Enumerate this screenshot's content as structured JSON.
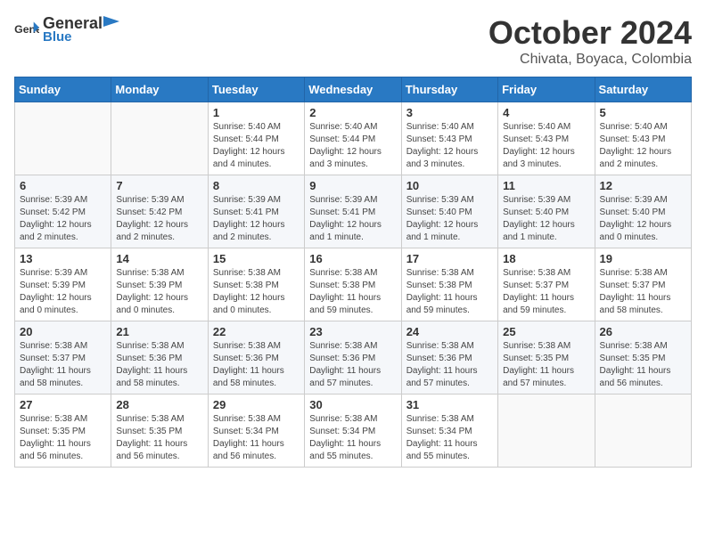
{
  "header": {
    "logo_general": "General",
    "logo_blue": "Blue",
    "month": "October 2024",
    "location": "Chivata, Boyaca, Colombia"
  },
  "weekdays": [
    "Sunday",
    "Monday",
    "Tuesday",
    "Wednesday",
    "Thursday",
    "Friday",
    "Saturday"
  ],
  "weeks": [
    [
      {
        "day": "",
        "detail": ""
      },
      {
        "day": "",
        "detail": ""
      },
      {
        "day": "1",
        "detail": "Sunrise: 5:40 AM\nSunset: 5:44 PM\nDaylight: 12 hours and 4 minutes."
      },
      {
        "day": "2",
        "detail": "Sunrise: 5:40 AM\nSunset: 5:44 PM\nDaylight: 12 hours and 3 minutes."
      },
      {
        "day": "3",
        "detail": "Sunrise: 5:40 AM\nSunset: 5:43 PM\nDaylight: 12 hours and 3 minutes."
      },
      {
        "day": "4",
        "detail": "Sunrise: 5:40 AM\nSunset: 5:43 PM\nDaylight: 12 hours and 3 minutes."
      },
      {
        "day": "5",
        "detail": "Sunrise: 5:40 AM\nSunset: 5:43 PM\nDaylight: 12 hours and 2 minutes."
      }
    ],
    [
      {
        "day": "6",
        "detail": "Sunrise: 5:39 AM\nSunset: 5:42 PM\nDaylight: 12 hours and 2 minutes."
      },
      {
        "day": "7",
        "detail": "Sunrise: 5:39 AM\nSunset: 5:42 PM\nDaylight: 12 hours and 2 minutes."
      },
      {
        "day": "8",
        "detail": "Sunrise: 5:39 AM\nSunset: 5:41 PM\nDaylight: 12 hours and 2 minutes."
      },
      {
        "day": "9",
        "detail": "Sunrise: 5:39 AM\nSunset: 5:41 PM\nDaylight: 12 hours and 1 minute."
      },
      {
        "day": "10",
        "detail": "Sunrise: 5:39 AM\nSunset: 5:40 PM\nDaylight: 12 hours and 1 minute."
      },
      {
        "day": "11",
        "detail": "Sunrise: 5:39 AM\nSunset: 5:40 PM\nDaylight: 12 hours and 1 minute."
      },
      {
        "day": "12",
        "detail": "Sunrise: 5:39 AM\nSunset: 5:40 PM\nDaylight: 12 hours and 0 minutes."
      }
    ],
    [
      {
        "day": "13",
        "detail": "Sunrise: 5:39 AM\nSunset: 5:39 PM\nDaylight: 12 hours and 0 minutes."
      },
      {
        "day": "14",
        "detail": "Sunrise: 5:38 AM\nSunset: 5:39 PM\nDaylight: 12 hours and 0 minutes."
      },
      {
        "day": "15",
        "detail": "Sunrise: 5:38 AM\nSunset: 5:38 PM\nDaylight: 12 hours and 0 minutes."
      },
      {
        "day": "16",
        "detail": "Sunrise: 5:38 AM\nSunset: 5:38 PM\nDaylight: 11 hours and 59 minutes."
      },
      {
        "day": "17",
        "detail": "Sunrise: 5:38 AM\nSunset: 5:38 PM\nDaylight: 11 hours and 59 minutes."
      },
      {
        "day": "18",
        "detail": "Sunrise: 5:38 AM\nSunset: 5:37 PM\nDaylight: 11 hours and 59 minutes."
      },
      {
        "day": "19",
        "detail": "Sunrise: 5:38 AM\nSunset: 5:37 PM\nDaylight: 11 hours and 58 minutes."
      }
    ],
    [
      {
        "day": "20",
        "detail": "Sunrise: 5:38 AM\nSunset: 5:37 PM\nDaylight: 11 hours and 58 minutes."
      },
      {
        "day": "21",
        "detail": "Sunrise: 5:38 AM\nSunset: 5:36 PM\nDaylight: 11 hours and 58 minutes."
      },
      {
        "day": "22",
        "detail": "Sunrise: 5:38 AM\nSunset: 5:36 PM\nDaylight: 11 hours and 58 minutes."
      },
      {
        "day": "23",
        "detail": "Sunrise: 5:38 AM\nSunset: 5:36 PM\nDaylight: 11 hours and 57 minutes."
      },
      {
        "day": "24",
        "detail": "Sunrise: 5:38 AM\nSunset: 5:36 PM\nDaylight: 11 hours and 57 minutes."
      },
      {
        "day": "25",
        "detail": "Sunrise: 5:38 AM\nSunset: 5:35 PM\nDaylight: 11 hours and 57 minutes."
      },
      {
        "day": "26",
        "detail": "Sunrise: 5:38 AM\nSunset: 5:35 PM\nDaylight: 11 hours and 56 minutes."
      }
    ],
    [
      {
        "day": "27",
        "detail": "Sunrise: 5:38 AM\nSunset: 5:35 PM\nDaylight: 11 hours and 56 minutes."
      },
      {
        "day": "28",
        "detail": "Sunrise: 5:38 AM\nSunset: 5:35 PM\nDaylight: 11 hours and 56 minutes."
      },
      {
        "day": "29",
        "detail": "Sunrise: 5:38 AM\nSunset: 5:34 PM\nDaylight: 11 hours and 56 minutes."
      },
      {
        "day": "30",
        "detail": "Sunrise: 5:38 AM\nSunset: 5:34 PM\nDaylight: 11 hours and 55 minutes."
      },
      {
        "day": "31",
        "detail": "Sunrise: 5:38 AM\nSunset: 5:34 PM\nDaylight: 11 hours and 55 minutes."
      },
      {
        "day": "",
        "detail": ""
      },
      {
        "day": "",
        "detail": ""
      }
    ]
  ]
}
